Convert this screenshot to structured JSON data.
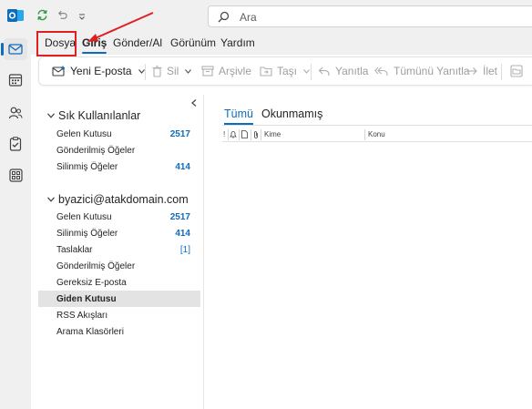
{
  "search": {
    "placeholder": "Ara"
  },
  "tabs": [
    {
      "label": "Dosya"
    },
    {
      "label": "Giriş"
    },
    {
      "label": "Gönder/Al"
    },
    {
      "label": "Görünüm"
    },
    {
      "label": "Yardım"
    }
  ],
  "ribbon": {
    "new_email": "Yeni E-posta",
    "delete": "Sil",
    "archive": "Arşivle",
    "move": "Taşı",
    "reply": "Yanıtla",
    "reply_all": "Tümünü Yanıtla",
    "forward": "İlet"
  },
  "folders": {
    "favorites": {
      "title": "Sık Kullanılanlar",
      "items": [
        {
          "label": "Gelen Kutusu",
          "count": "2517"
        },
        {
          "label": "Gönderilmiş Öğeler",
          "count": ""
        },
        {
          "label": "Silinmiş Öğeler",
          "count": "414"
        }
      ]
    },
    "account": {
      "title": "byazici@atakdomain.com",
      "items": [
        {
          "label": "Gelen Kutusu",
          "count": "2517"
        },
        {
          "label": "Silinmiş Öğeler",
          "count": "414"
        },
        {
          "label": "Taslaklar",
          "count": "[1]"
        },
        {
          "label": "Gönderilmiş Öğeler",
          "count": ""
        },
        {
          "label": "Gereksiz E-posta",
          "count": ""
        },
        {
          "label": "Giden Kutusu",
          "count": ""
        },
        {
          "label": "RSS Akışları",
          "count": ""
        },
        {
          "label": "Arama Klasörleri",
          "count": ""
        }
      ]
    }
  },
  "list": {
    "tabs": [
      {
        "label": "Tümü"
      },
      {
        "label": "Okunmamış"
      }
    ],
    "columns": {
      "important": "!",
      "to": "Kime",
      "subject": "Konu"
    }
  },
  "colors": {
    "accent": "#0f6cbd",
    "highlight": "#e02020",
    "selected": "#e3e3e3"
  }
}
